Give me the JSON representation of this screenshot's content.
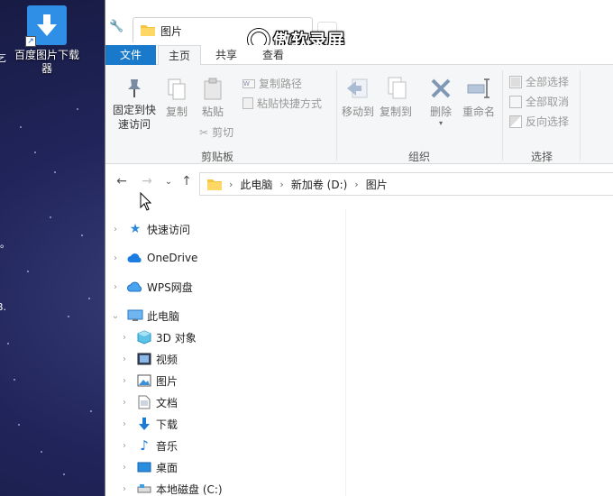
{
  "desktop": {
    "icon_label": "百度图片下载器",
    "icon_label_line1": "百度图片下载",
    "icon_label_line2": "器",
    "edge_glyphs": [
      "乞",
      "。",
      "B."
    ]
  },
  "window": {
    "tab_title": "图片",
    "watermark": "傲软录屏",
    "ribbon_tabs": {
      "file": "文件",
      "home": "主页",
      "share": "共享",
      "view": "查看"
    },
    "clipboard": {
      "pin_label_1": "固定到快",
      "pin_label_2": "速访问",
      "copy": "复制",
      "paste": "粘贴",
      "copy_path": "复制路径",
      "paste_shortcut": "粘贴快捷方式",
      "cut": "剪切",
      "group": "剪贴板"
    },
    "organize": {
      "move_to": "移动到",
      "copy_to": "复制到",
      "delete": "删除",
      "rename": "重命名",
      "group": "组织"
    },
    "select": {
      "select_all": "全部选择",
      "select_none": "全部取消",
      "invert": "反向选择",
      "group": "选择"
    },
    "address": [
      "此电脑",
      "新加卷 (D:)",
      "图片"
    ],
    "nav_pane": [
      {
        "label": "快速访问",
        "level": 0
      },
      {
        "label": "OneDrive",
        "level": 0
      },
      {
        "label": "WPS网盘",
        "level": 0
      },
      {
        "label": "此电脑",
        "level": 0,
        "expanded": true
      },
      {
        "label": "3D 对象",
        "level": 1
      },
      {
        "label": "视频",
        "level": 1
      },
      {
        "label": "图片",
        "level": 1
      },
      {
        "label": "文档",
        "level": 1
      },
      {
        "label": "下载",
        "level": 1
      },
      {
        "label": "音乐",
        "level": 1
      },
      {
        "label": "桌面",
        "level": 1
      },
      {
        "label": "本地磁盘 (C:)",
        "level": 1
      }
    ]
  },
  "colors": {
    "file_tab": "#1979ca",
    "accent": "#2f8ee6"
  }
}
